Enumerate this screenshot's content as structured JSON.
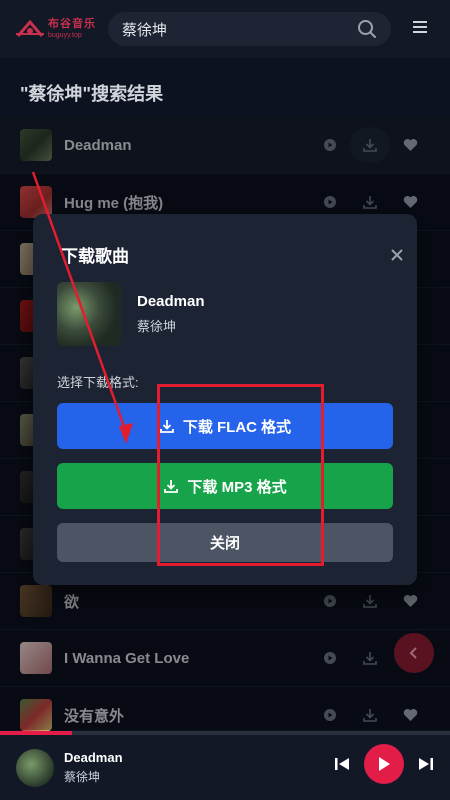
{
  "header": {
    "logo_name": "布谷音乐",
    "logo_sub": "buguyy.top",
    "search_value": "蔡徐坤"
  },
  "results_title": "\"蔡徐坤\"搜索结果",
  "songs": [
    {
      "title": "Deadman"
    },
    {
      "title": "Hug me (抱我)"
    },
    {
      "title": ""
    },
    {
      "title": ""
    },
    {
      "title": ""
    },
    {
      "title": ""
    },
    {
      "title": ""
    },
    {
      "title": ""
    },
    {
      "title": "欲"
    },
    {
      "title": "I Wanna Get Love"
    },
    {
      "title": "没有意外"
    }
  ],
  "modal": {
    "title": "下载歌曲",
    "song_name": "Deadman",
    "artist": "蔡徐坤",
    "format_label": "选择下载格式:",
    "flac_label": "下载 FLAC 格式",
    "mp3_label": "下载 MP3 格式",
    "close_label": "关闭"
  },
  "player": {
    "title": "Deadman",
    "artist": "蔡徐坤",
    "progress": 0.16
  },
  "colors": {
    "accent": "#e11d48",
    "flac": "#2563eb",
    "mp3": "#16a34a",
    "annotation": "#e11d2f"
  }
}
